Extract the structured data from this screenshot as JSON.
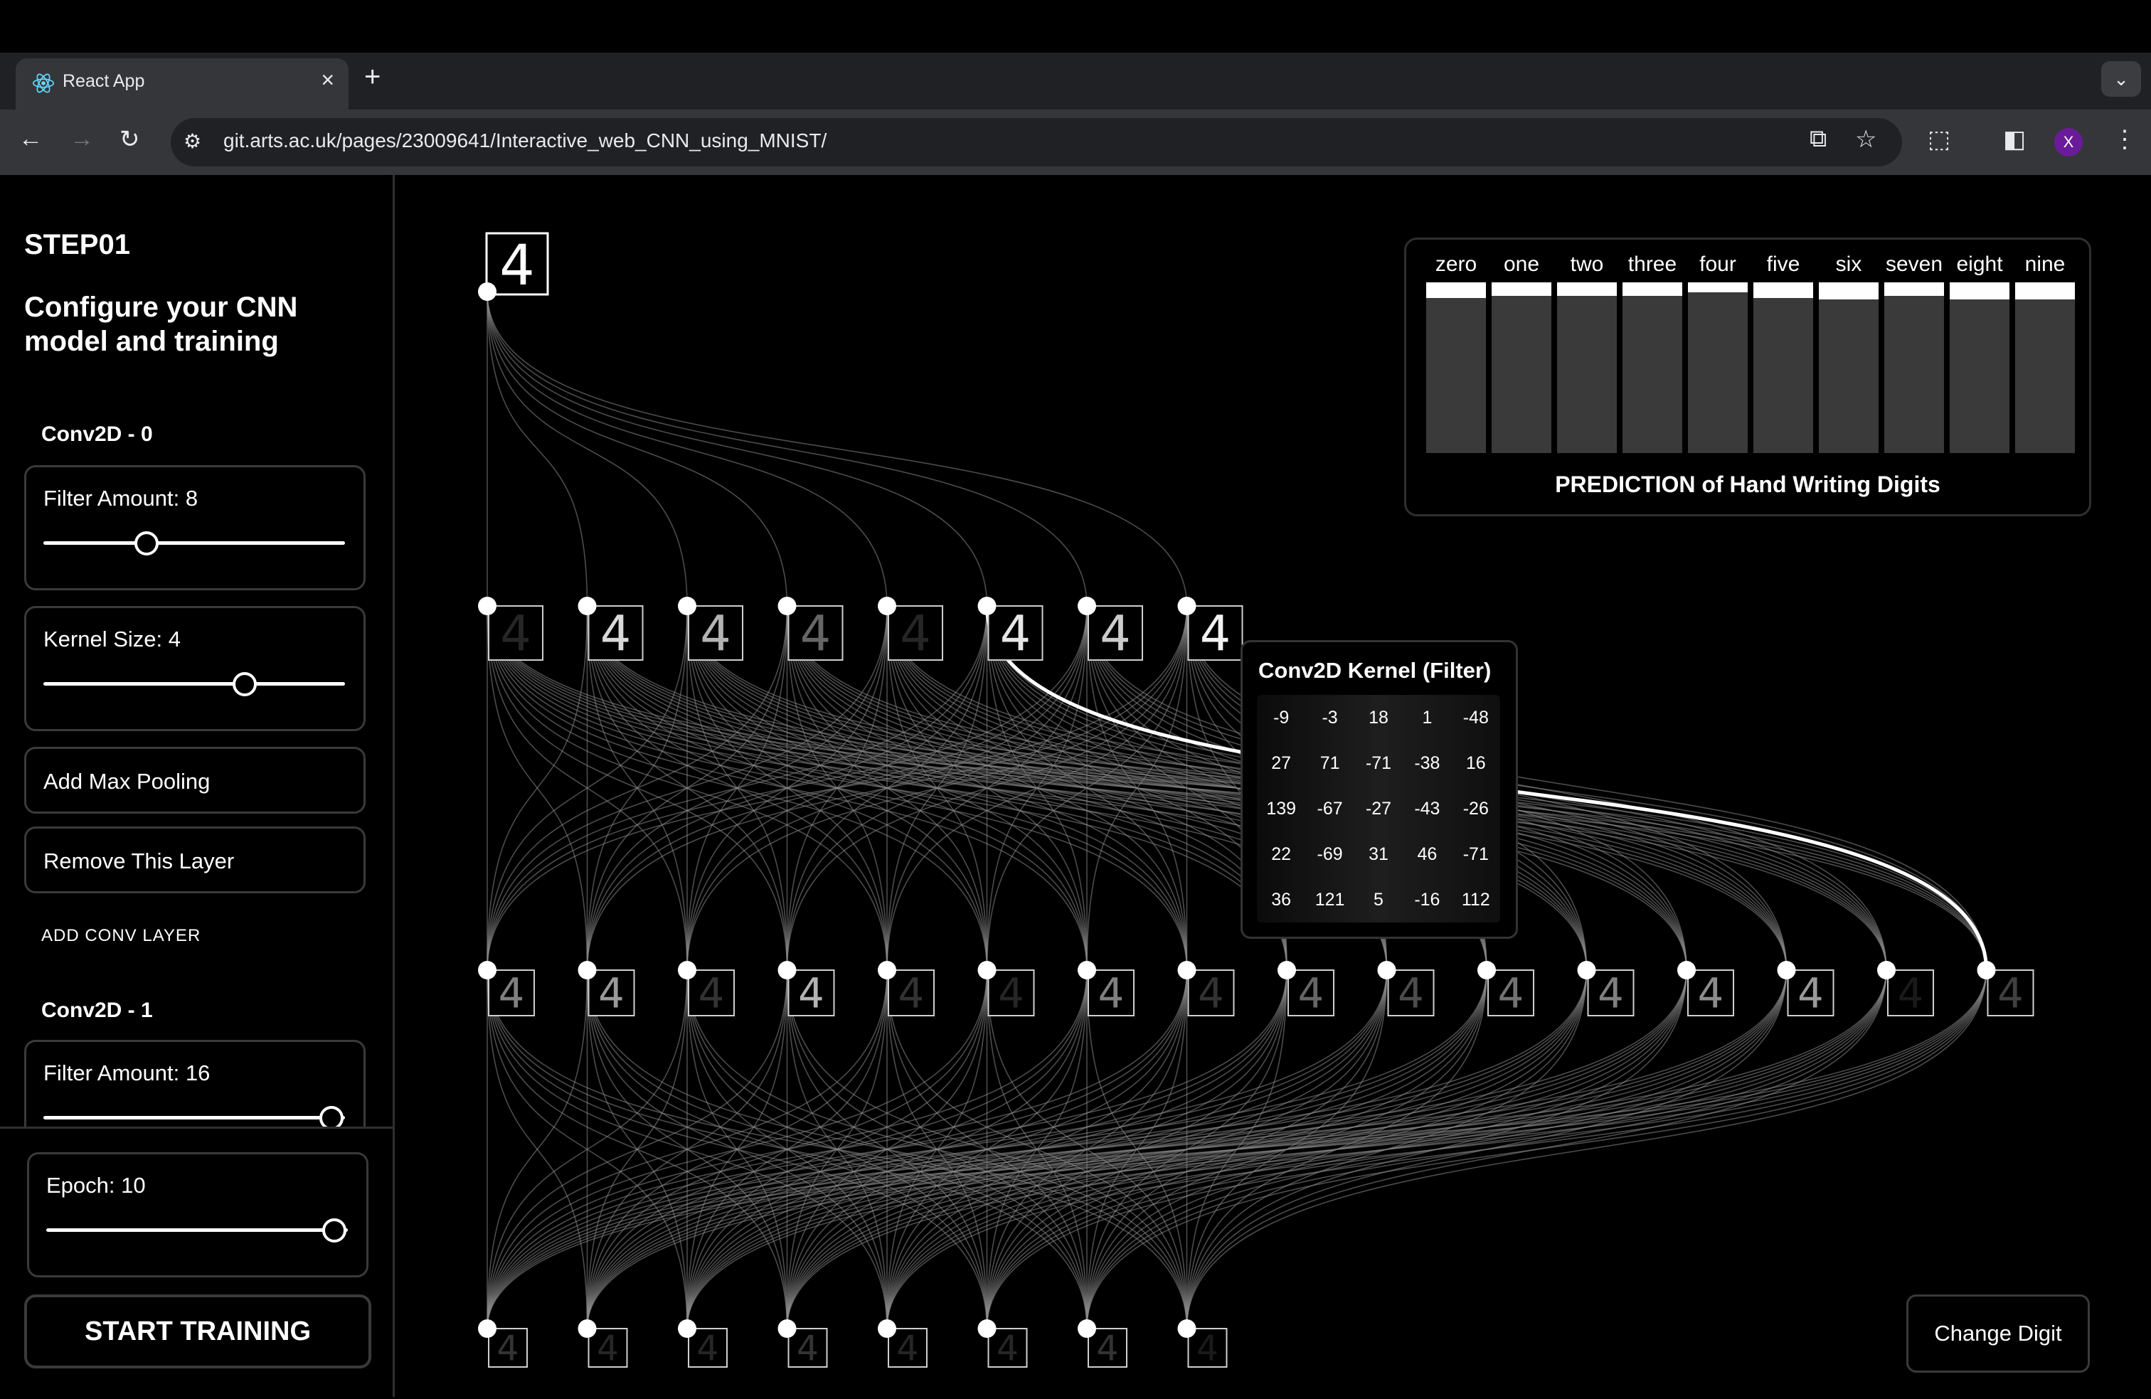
{
  "browser": {
    "tab_title": "React App",
    "url": "git.arts.ac.uk/pages/23009641/Interactive_web_CNN_using_MNIST/",
    "avatar_initial": "X",
    "icons": [
      "react-logo-icon",
      "close-icon",
      "plus-icon",
      "chevron-down-icon",
      "back-arrow-icon",
      "forward-arrow-icon",
      "reload-icon",
      "site-info-icon",
      "install-app-icon",
      "star-icon",
      "extensions-icon",
      "side-panel-icon",
      "more-vert-icon"
    ]
  },
  "sidebar": {
    "step": "STEP01",
    "title": "Configure your CNN model and training",
    "layers": [
      {
        "name": "Conv2D - 0",
        "filter_label": "Filter Amount: 8",
        "filter_value_fraction": 0.33,
        "kernel_label": "Kernel Size: 4",
        "kernel_value_fraction": 0.67,
        "add_pool_label": "Add Max Pooling",
        "remove_label": "Remove This Layer"
      },
      {
        "name": "Conv2D - 1",
        "filter_label": "Filter Amount: 16",
        "filter_value_fraction": 1.0
      }
    ],
    "add_conv_label": "ADD CONV LAYER",
    "epoch_label": "Epoch: 10",
    "epoch_value_fraction": 1.0,
    "start_training_label": "START TRAINING"
  },
  "prediction": {
    "title": "PREDICTION of Hand Writing Digits",
    "classes": [
      "zero",
      "one",
      "two",
      "three",
      "four",
      "five",
      "six",
      "seven",
      "eight",
      "nine"
    ],
    "probabilities": [
      0.09,
      0.08,
      0.08,
      0.08,
      0.06,
      0.09,
      0.1,
      0.08,
      0.1,
      0.1
    ]
  },
  "network": {
    "input_digit": "4",
    "layer_sizes": [
      1,
      8,
      16,
      8
    ],
    "preview_digit": "4"
  },
  "kernel_popup": {
    "title": "Conv2D Kernel (Filter)",
    "values": [
      [
        "-9",
        "-3",
        "18",
        "1",
        "-48"
      ],
      [
        "27",
        "71",
        "-71",
        "-38",
        "16"
      ],
      [
        "139",
        "-67",
        "-27",
        "-43",
        "-26"
      ],
      [
        "22",
        "-69",
        "31",
        "46",
        "-71"
      ],
      [
        "36",
        "121",
        "5",
        "-16",
        "112"
      ]
    ]
  },
  "change_digit_label": "Change Digit"
}
